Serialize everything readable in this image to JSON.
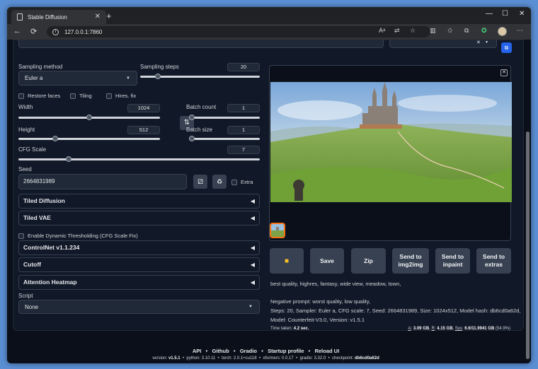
{
  "browser": {
    "tab_title": "Stable Diffusion",
    "url": "127.0.0.1:7860"
  },
  "left": {
    "sampling_method_label": "Sampling method",
    "sampling_method_value": "Euler a",
    "sampling_steps_label": "Sampling steps",
    "sampling_steps_value": "20",
    "sampling_steps_fraction": 0.13,
    "restore_faces": "Restore faces",
    "tiling": "Tiling",
    "hires_fix": "Hires. fix",
    "width_label": "Width",
    "width_value": "1024",
    "width_fraction": 0.5,
    "height_label": "Height",
    "height_value": "512",
    "height_fraction": 0.25,
    "batch_count_label": "Batch count",
    "batch_count_value": "1",
    "batch_size_label": "Batch size",
    "batch_size_value": "1",
    "cfg_label": "CFG Scale",
    "cfg_value": "7",
    "cfg_fraction": 0.2,
    "seed_label": "Seed",
    "seed_value": "2664831989",
    "extra_label": "Extra",
    "tiled_diffusion": "Tiled Diffusion",
    "tiled_vae": "Tiled VAE",
    "dynamic_thresholding": "Enable Dynamic Thresholding (CFG Scale Fix)",
    "controlnet": "ControlNet v1.1.234",
    "cutoff": "Cutoff",
    "attention_heatmap": "Attention Heatmap",
    "script_label": "Script",
    "script_value": "None"
  },
  "right": {
    "buttons": {
      "save": "Save",
      "zip": "Zip",
      "send_img2img": "Send to img2img",
      "send_inpaint": "Send to inpaint",
      "send_extras": "Send to extras"
    },
    "prompt": "best quality, highres, fantasy, wide view, meadow, town,",
    "negative_prompt": "Negative prompt: worst quality, low quality,",
    "params_line1": "Steps: 20, Sampler: Euler a, CFG scale: 7, Seed: 2664831989, Size: 1024x512, Model hash: db6cd0a62d,",
    "params_line2": "Model: Counterfeit-V3.0, Version: v1.5.1",
    "time_taken_label": "Time taken:",
    "time_taken_value": "4.2 sec.",
    "vram": {
      "a_label": "A",
      "a_value": "3.09 GB",
      "r_label": "R",
      "r_value": "4.15 GB",
      "sys_label": "Sys",
      "sys_value": "6.6/11.9941 GB",
      "sys_percent": "(54.9%)"
    }
  },
  "footer": {
    "links": [
      "API",
      "Github",
      "Gradio",
      "Startup profile",
      "Reload UI"
    ],
    "version_label": "version:",
    "version": "v1.5.1",
    "python_label": "python:",
    "python": "3.10.11",
    "torch_label": "torch:",
    "torch": "2.0.1+cu118",
    "xformers_label": "xformers:",
    "xformers": "0.0.17",
    "gradio_label": "gradio:",
    "gradio": "3.32.0",
    "checkpoint_label": "checkpoint:",
    "checkpoint": "db6cd0a62d"
  },
  "colors": {
    "background": "#0b0f19",
    "panel": "#111827",
    "input": "#1f2937",
    "button": "#374151",
    "accent_orange": "#f97316",
    "accent_blue": "#2563eb"
  }
}
